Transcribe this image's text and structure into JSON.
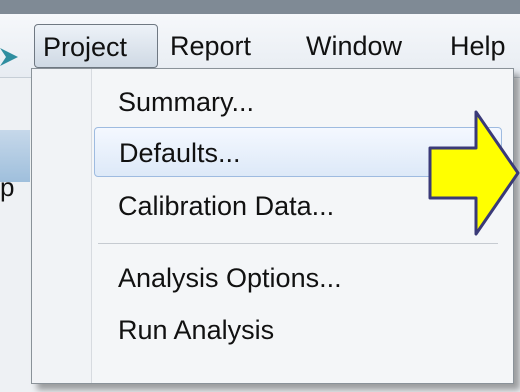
{
  "menubar": {
    "items": [
      {
        "label": "Project"
      },
      {
        "label": "Report"
      },
      {
        "label": "Window"
      },
      {
        "label": "Help"
      }
    ]
  },
  "background_clipped_text": "p",
  "project_menu": {
    "items": [
      {
        "label": "Summary..."
      },
      {
        "label": "Defaults...",
        "highlighted": true
      },
      {
        "label": "Calibration Data..."
      },
      {
        "label": "Analysis Options..."
      },
      {
        "label": "Run Analysis"
      }
    ]
  },
  "annotations": {
    "pointer_color": "#2f8ea0",
    "callout_arrow_fill": "#ffff00",
    "callout_arrow_stroke": "#3a3a78",
    "accent_highlight": "#9ebbe0"
  }
}
